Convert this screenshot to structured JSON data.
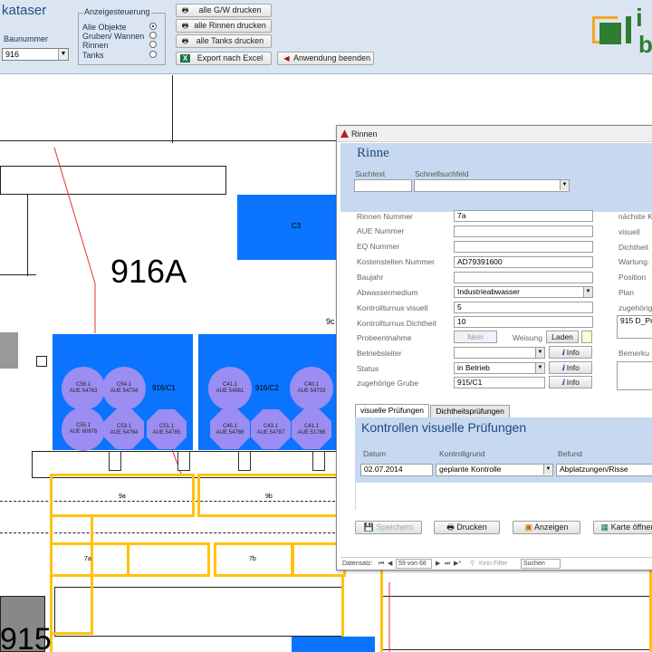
{
  "app": {
    "title": "kataser",
    "baunummer_label": "Baunummer",
    "baunummer_value": "916"
  },
  "anzeige": {
    "legend": "Anzeigesteuerung",
    "options": [
      {
        "label": "Alle Objekte",
        "selected": true
      },
      {
        "label": "Gruben/ Wannen",
        "selected": false
      },
      {
        "label": "Rinnen",
        "selected": false
      },
      {
        "label": "Tanks",
        "selected": false
      }
    ]
  },
  "toolbar": {
    "print_gw": "alle G/W drucken",
    "print_rinnen": "alle Rinnen drucken",
    "print_tanks": "alle Tanks drucken",
    "export_excel": "Export nach Excel",
    "exit": "Anwendung beenden"
  },
  "logo": {
    "text_top": "i",
    "text_bottom": "b"
  },
  "plan": {
    "building": "916A",
    "building_bottom": "915",
    "room_c3": "C3",
    "label_9c": "9c",
    "tank_c1": "916/C1",
    "tank_c2": "916/C2",
    "rinne_9a": "9a",
    "rinne_9b": "9b",
    "rinne_7a": "7a",
    "rinne_7b": "7b",
    "objects_c1": [
      {
        "id": "C56.1",
        "aue": "AUE 54763"
      },
      {
        "id": "C54.1",
        "aue": "AUE 54734"
      },
      {
        "id": "C55.1",
        "aue": "AUE 60876"
      },
      {
        "id": "C53.1",
        "aue": "AUE 54784"
      },
      {
        "id": "C51.1",
        "aue": "AUE 54785"
      }
    ],
    "objects_c2": [
      {
        "id": "C41.1",
        "aue": "AUE 54981"
      },
      {
        "id": "C40.1",
        "aue": "AUE 54733"
      },
      {
        "id": "C45.1",
        "aue": "AUE 54786"
      },
      {
        "id": "C43.1",
        "aue": "AUE 54787"
      },
      {
        "id": "C41.1",
        "aue": "AUE 51786"
      }
    ]
  },
  "dialog": {
    "window_title": "Rinnen",
    "heading": "Rinne",
    "suchtext_label": "Suchtext",
    "schnellsuch_label": "Schnellsuchfeld",
    "fields": {
      "rinnen_nummer": {
        "label": "Rinnen Nummer",
        "value": "7a"
      },
      "aue_nummer": {
        "label": "AUE Nummer",
        "value": ""
      },
      "eq_nummer": {
        "label": "EQ Nummer",
        "value": ""
      },
      "kostenstellen_nummer": {
        "label": "Kostenstellen Nummer",
        "value": "AD79391600"
      },
      "baujahr": {
        "label": "Baujahr",
        "value": ""
      },
      "abwassermedium": {
        "label": "Abwassermedium",
        "value": "Industrieabwasser"
      },
      "kontrollturnus_visuell": {
        "label": "Kontrollturnus visuell",
        "value": "5"
      },
      "kontrollturnus_dichtheit": {
        "label": "Kontrollturnus Dichtheit",
        "value": "10"
      },
      "probeentnahme": {
        "label": "Probeentnahme",
        "value": "Nein"
      },
      "weisung": {
        "label": "Weisung",
        "button": "Laden"
      },
      "betriebsleiter": {
        "label": "Betriebsleiter",
        "value": ""
      },
      "status": {
        "label": "Status",
        "value": "in Betrieb"
      },
      "grube": {
        "label": "zugehörige Grube",
        "value": "915/C1"
      }
    },
    "info_label": "Info",
    "right_labels": [
      "nächste K",
      "visuell",
      "Dichtheit",
      "Wartung:",
      "Position",
      "Plan",
      "zugehörig"
    ],
    "plan_value": "915 D_Pr",
    "bemerkung_label": "Bemerku",
    "tabs": [
      "visuelle Prüfungen",
      "Dichtheitsprüfungen"
    ],
    "sub_heading": "Kontrollen visuelle Prüfungen",
    "sub_columns": [
      "Datum",
      "Kontrollgrund",
      "Befund"
    ],
    "sub_row": {
      "datum": "02.07.2014",
      "kontrollgrund": "geplante Kontrolle",
      "befund": "Abplatzungen/Risse"
    },
    "buttons": {
      "speichern": "Speichern",
      "drucken": "Drucken",
      "anzeigen": "Anzeigen",
      "karte": "Karte öffnen"
    },
    "nav": {
      "label": "Datensatz:",
      "position": "59 von 68",
      "filter": "Kein Filter",
      "search": "Suchen"
    }
  }
}
